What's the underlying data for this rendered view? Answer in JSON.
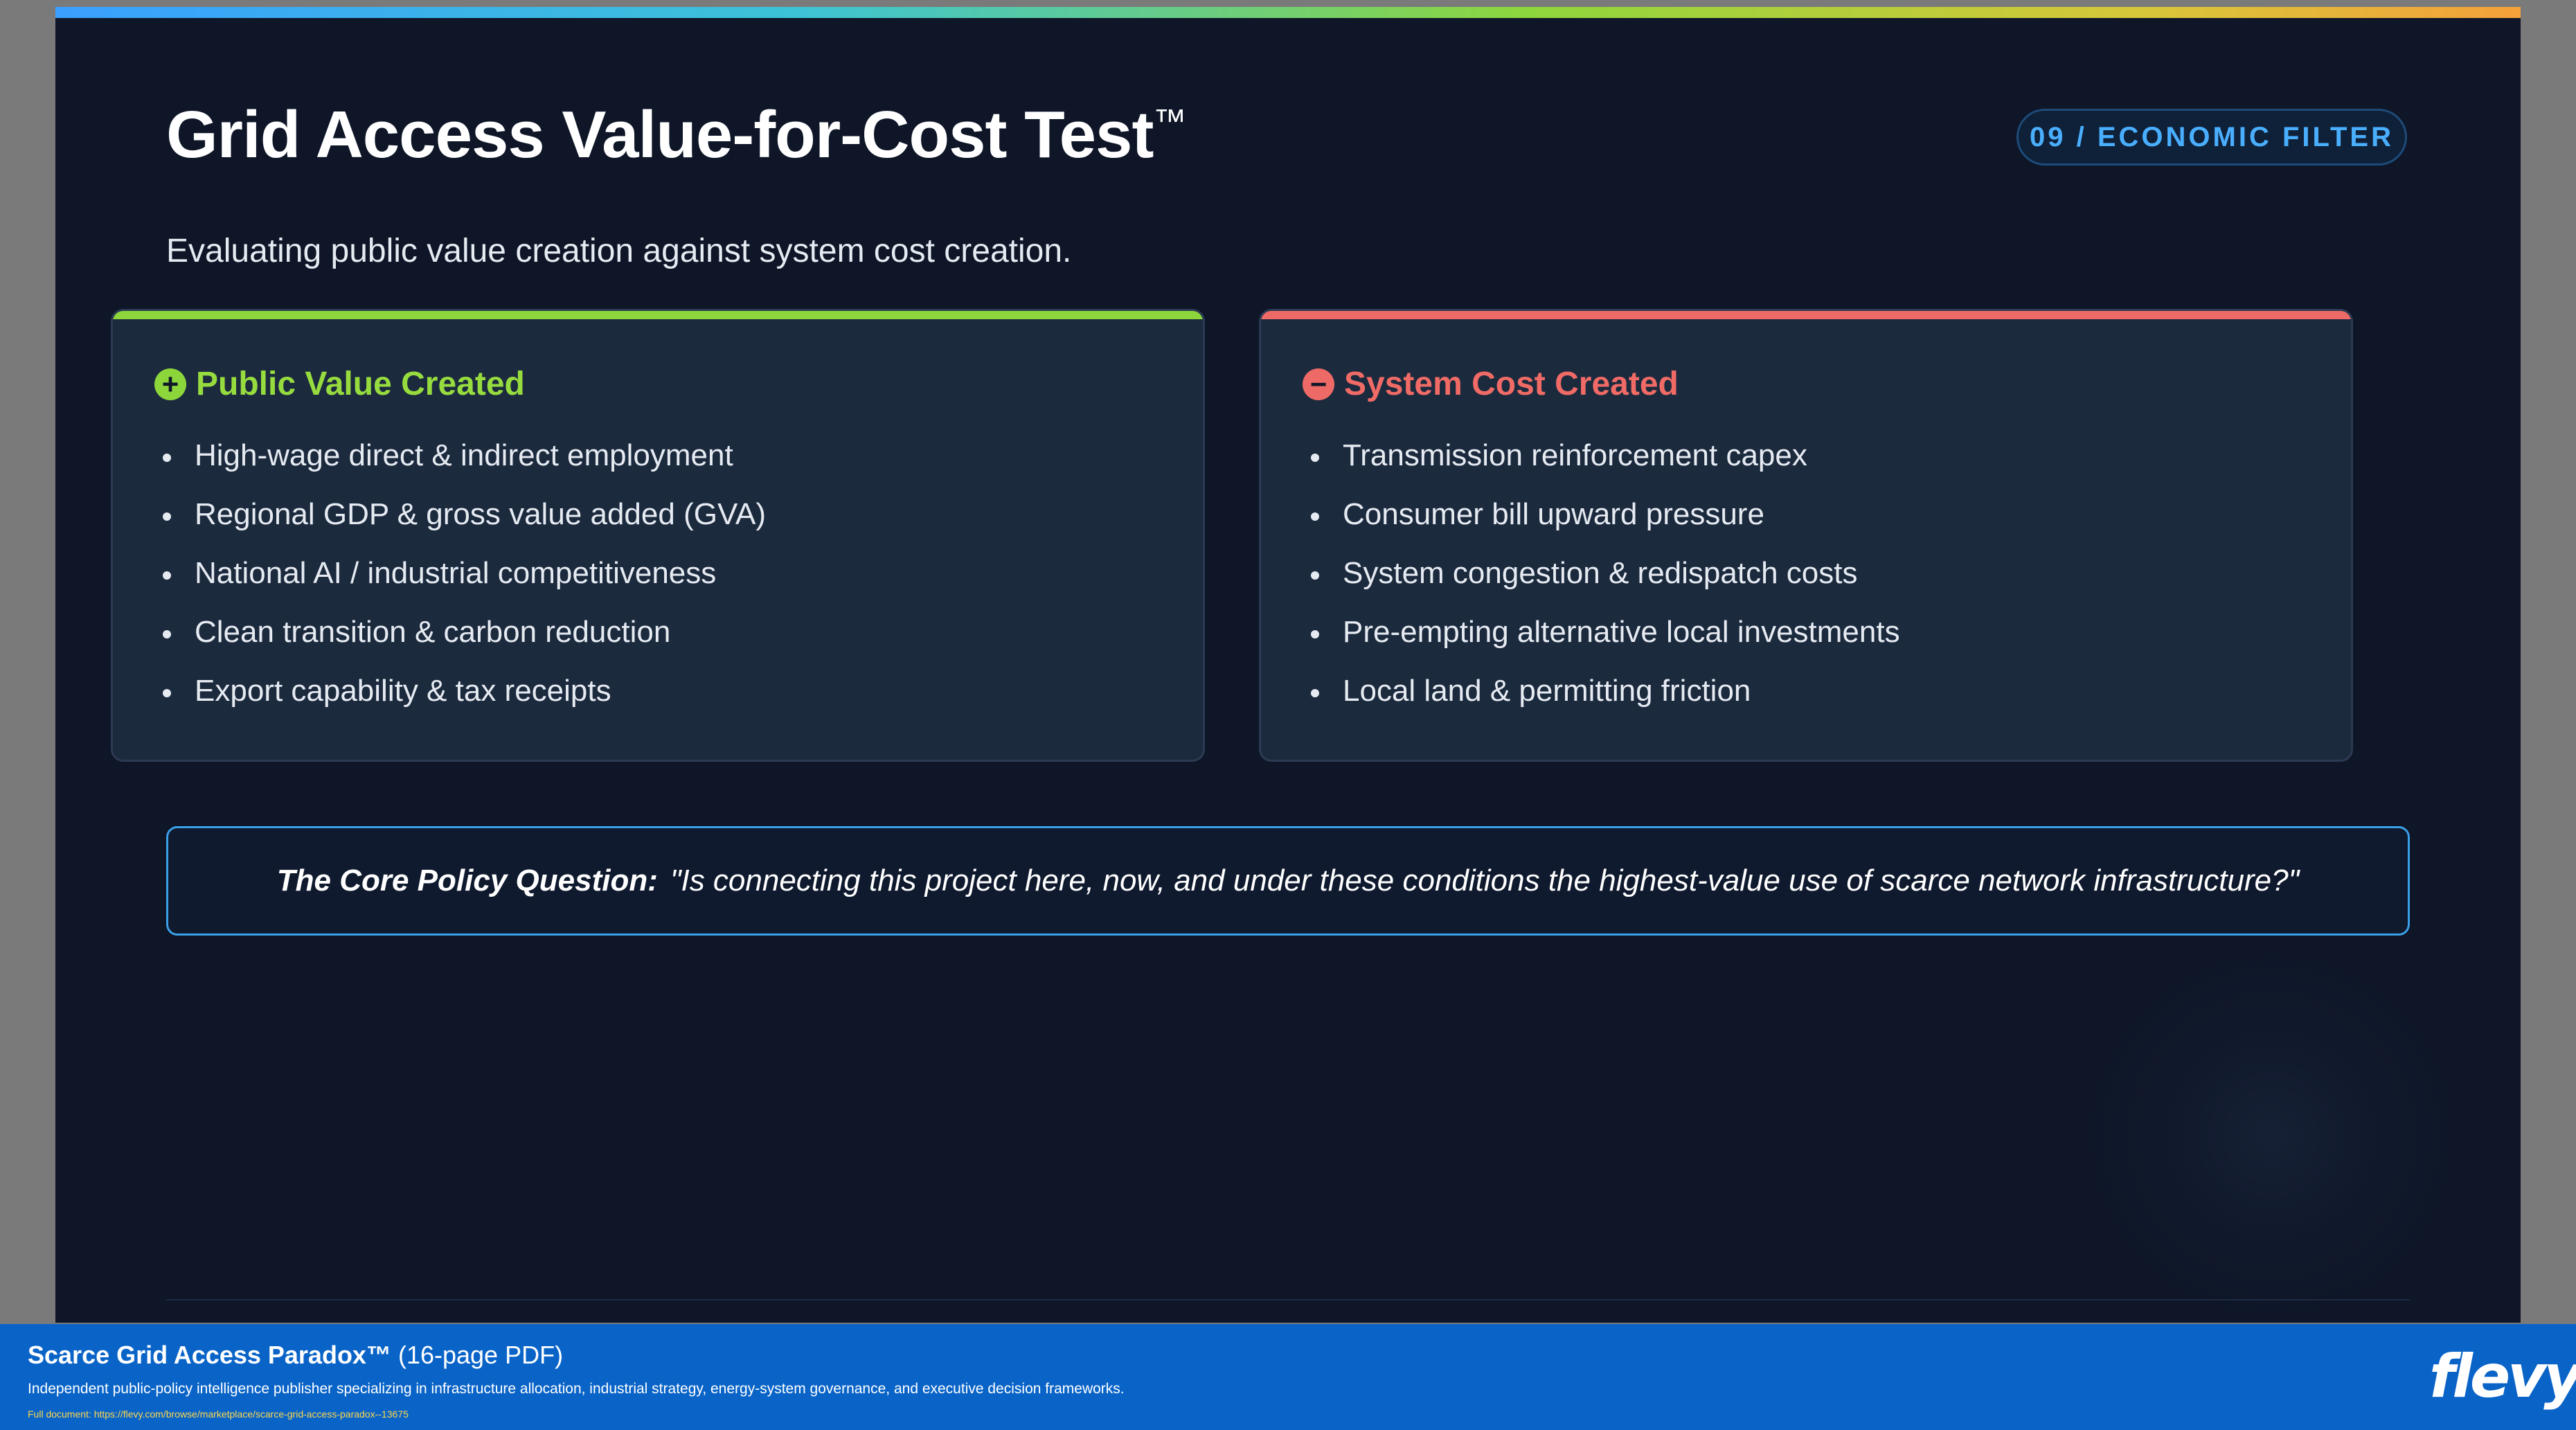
{
  "slide": {
    "title": "Grid Access Value-for-Cost Test",
    "title_mark": "™",
    "badge": "09 / ECONOMIC FILTER",
    "subtitle": "Evaluating public value creation against system cost creation."
  },
  "cards": {
    "value": {
      "icon": "plus-circle-icon",
      "icon_glyph": "+",
      "heading": "Public Value Created",
      "accent": "#8cd63c",
      "items": [
        "High-wage direct & indirect employment",
        "Regional GDP & gross value added (GVA)",
        "National AI / industrial competitiveness",
        "Clean transition & carbon reduction",
        "Export capability & tax receipts"
      ]
    },
    "cost": {
      "icon": "minus-circle-icon",
      "icon_glyph": "−",
      "heading": "System Cost Created",
      "accent": "#ee6a66",
      "items": [
        "Transmission reinforcement capex",
        "Consumer bill upward pressure",
        "System congestion & redispatch costs",
        "Pre-empting alternative local investments",
        "Local land & permitting friction"
      ]
    }
  },
  "question": {
    "label": "The Core Policy Question:",
    "text": "\"Is connecting this project here, now, and under these conditions the highest-value use of scarce network infrastructure?\""
  },
  "footer": {
    "doc_title": "Scarce Grid Access Paradox™",
    "pages": " (16-page PDF)",
    "description": "Independent public-policy intelligence publisher specializing in infrastructure allocation, industrial strategy, energy-system governance, and executive decision frameworks.",
    "link": "Full document: https://flevy.com/browse/marketplace/scarce-grid-access-paradox--13675",
    "logo": "flevy"
  },
  "colors": {
    "slide_bg": "#0e1628",
    "card_bg": "#1c2a3e",
    "badge_text": "#4aaeff",
    "question_border": "#3aa0e8",
    "footer_bg": "#0a64c8"
  }
}
